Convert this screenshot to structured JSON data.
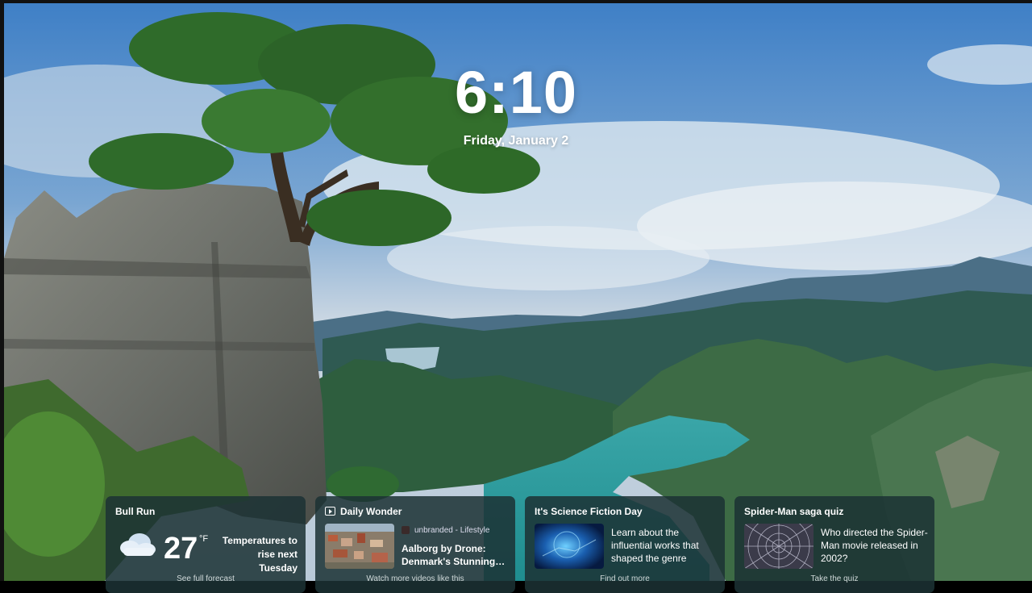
{
  "lock_screen": {
    "time": "6:10",
    "date": "Friday, January 2"
  },
  "widgets": {
    "weather": {
      "location": "Bull Run",
      "temperature": "27",
      "unit": "°F",
      "description": "Temperatures to rise next Tuesday",
      "footer": "See full forecast",
      "icon": "cloud-icon"
    },
    "daily_wonder": {
      "title": "Daily Wonder",
      "source": "unbranded - Lifestyle",
      "headline": "Aalborg by Drone: Denmark's Stunning…",
      "footer": "Watch more videos like this",
      "icon": "video-icon"
    },
    "science_fiction": {
      "title": "It's Science Fiction Day",
      "text": "Learn about the influential works that shaped the genre",
      "footer": "Find out more"
    },
    "spiderman": {
      "title": "Spider-Man saga quiz",
      "text": "Who directed the Spider-Man movie released in 2002?",
      "footer": "Take the quiz"
    }
  }
}
